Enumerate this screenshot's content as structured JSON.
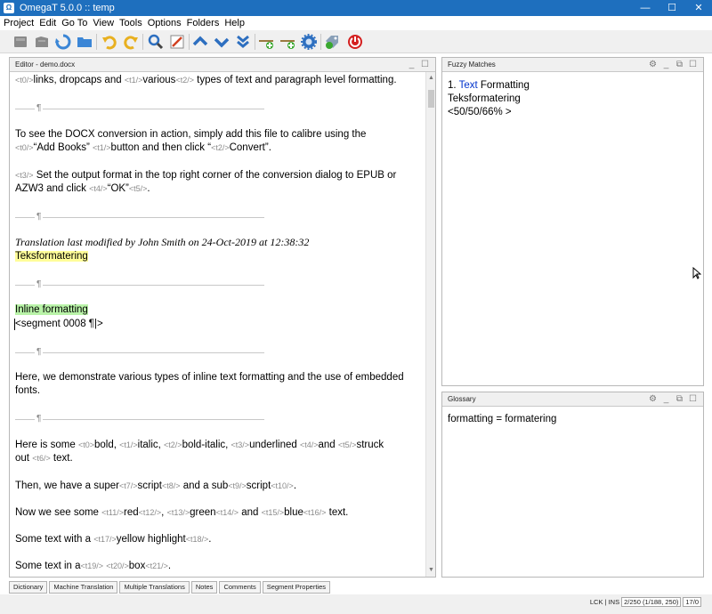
{
  "window": {
    "title": "OmegaT 5.0.0 :: temp",
    "app_icon_glyph": "Ω",
    "minimize": "—",
    "maximize": "☐",
    "close": "✕"
  },
  "menu": [
    "Project",
    "Edit",
    "Go To",
    "View",
    "Tools",
    "Options",
    "Folders",
    "Help"
  ],
  "toolbar": {
    "icons": [
      "open-project-icon",
      "save-project-icon",
      "reload-icon",
      "folder-icon",
      "undo-icon",
      "redo-icon",
      "search-icon",
      "edit-icon",
      "previous-segment-icon",
      "next-segment-icon",
      "next-untranslated-icon",
      "insert-match-icon",
      "replace-match-icon",
      "settings-icon",
      "validate-tags-icon",
      "quit-icon"
    ]
  },
  "editor": {
    "title": "Editor - demo.docx",
    "para_mark": "¶",
    "lines": {
      "l1": {
        "tag1": "<t0/>",
        "text1": "links, dropcaps and ",
        "tag2": "<t1/>",
        "text2": "various",
        "tag3": "<t2/>",
        "text3": " types of text and paragraph level formatting."
      },
      "l2": "To see the DOCX conversion in action, simply add this file to calibre using the",
      "l3": {
        "tag1": "<t0/>",
        "text1": "“Add Books” ",
        "tag2": "<t1/>",
        "text2": "button and then click “",
        "tag3": "<t2/>",
        "text3": "Convert”."
      },
      "l4": {
        "tag1": "<t3/>",
        "text1": " Set the output format in the top right corner of the conversion dialog to EPUB or"
      },
      "l5": {
        "text1": "AZW3 and click ",
        "tag1": "<t4/>",
        "text2": "“OK”",
        "tag2": "<t5/>",
        "text3": "."
      },
      "l6": "Translation last modified by John Smith on 24-Oct-2019 at 12:38:32",
      "l7": "Teksformatering",
      "l8": "Inline formatting",
      "l9": "<segment 0008 ¶|>",
      "l10": "Here, we demonstrate various types of inline text formatting and the use of embedded",
      "l11": "fonts.",
      "l12": {
        "text1": "Here is some ",
        "tag1": "<t0>",
        "text2": "bold, ",
        "tag2": "<t1/>",
        "text3": "italic, ",
        "tag3": "<t2/>",
        "text4": "bold-italic, ",
        "tag4": "<t3/>",
        "text5": "underlined ",
        "tag5": "<t4/>",
        "text6": "and ",
        "tag6": "<t5/>",
        "text7": "struck"
      },
      "l13": {
        "text1": "out ",
        "tag1": "<t6/>",
        "text2": " text."
      },
      "l14": {
        "text1": "Then, we have a super",
        "tag1": "<t7/>",
        "text2": "script",
        "tag2": "<t8/>",
        "text3": " and a sub",
        "tag3": "<t9/>",
        "text4": "script",
        "tag4": "<t10/>",
        "text5": "."
      },
      "l15": {
        "text1": "Now we see some ",
        "tag1": "<t11/>",
        "text2": "red",
        "tag2": "<t12/>",
        "text3": ", ",
        "tag3": "<t13/>",
        "text4": "green",
        "tag4": "<t14/>",
        "text5": " and ",
        "tag5": "<t15/>",
        "text6": "blue",
        "tag6": "<t16/>",
        "text7": " text."
      },
      "l16": {
        "text1": "Some text with a ",
        "tag1": "<t17/>",
        "text2": "yellow highlight",
        "tag2": "<t18/>",
        "text3": "."
      },
      "l17": {
        "text1": "Some text in a",
        "tag1": "<t19/>",
        "text2": " ",
        "tag2": "<t20/>",
        "text3": "box",
        "tag3": "<t21/>",
        "text4": "."
      }
    }
  },
  "fuzzy": {
    "title": "Fuzzy Matches",
    "number": "1.",
    "source_match": "Text",
    "source_rest": " Formatting",
    "target": "Teksformatering",
    "score": "<50/50/66% >"
  },
  "glossary": {
    "title": "Glossary",
    "entry": "formatting = formatering"
  },
  "tabs": [
    "Dictionary",
    "Machine Translation",
    "Multiple Translations",
    "Notes",
    "Comments",
    "Segment Properties"
  ],
  "status": {
    "mode": "LCK | INS",
    "progress": "2/250 (1/188, 250)",
    "segment": "17/0"
  },
  "colors": {
    "titlebar": "#1e6fbe",
    "tag": "#8a8a8a",
    "source_highlight": "#b9f3a8",
    "target_highlight": "#fffd99",
    "match_word": "#0033cc"
  }
}
